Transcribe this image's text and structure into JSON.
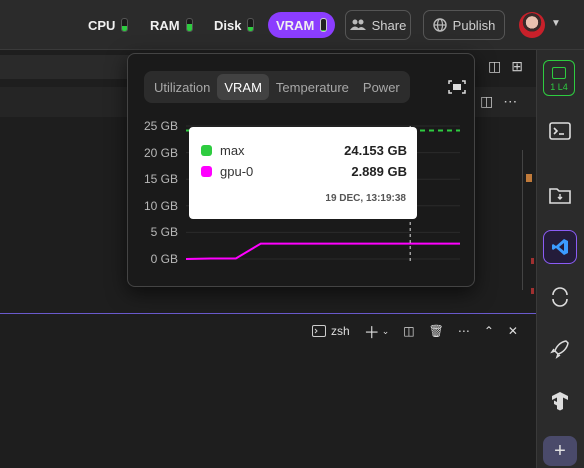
{
  "topbar": {
    "metrics": [
      {
        "label": "CPU",
        "level": 0.4
      },
      {
        "label": "RAM",
        "level": 0.55
      },
      {
        "label": "Disk",
        "level": 0.3
      },
      {
        "label": "VRAM",
        "level": 0.1
      }
    ],
    "share_label": "Share",
    "publish_label": "Publish"
  },
  "sidebar": {
    "gpu_badge": "1 L4"
  },
  "terminal": {
    "shell_label": "zsh"
  },
  "popup": {
    "tabs": [
      "Utilization",
      "VRAM",
      "Temperature",
      "Power"
    ],
    "active_tab": "VRAM",
    "tooltip": {
      "rows": [
        {
          "name": "max",
          "value": "24.153 GB",
          "color": "#2ecc40"
        },
        {
          "name": "gpu-0",
          "value": "2.889 GB",
          "color": "#ff00ff"
        }
      ],
      "time": "19 DEC, 13:19:38"
    }
  },
  "chart_data": {
    "type": "line",
    "title": "",
    "xlabel": "",
    "ylabel": "",
    "y_ticks": [
      "25 GB",
      "20 GB",
      "15 GB",
      "10 GB",
      "5 GB",
      "0 GB"
    ],
    "ylim": [
      0,
      25
    ],
    "grid": true,
    "series": [
      {
        "name": "max",
        "color": "#2ecc40",
        "style": "dashed",
        "values": [
          24.153,
          24.153,
          24.153,
          24.153,
          24.153,
          24.153,
          24.153,
          24.153,
          24.153,
          24.153,
          24.153,
          24.153
        ]
      },
      {
        "name": "gpu-0",
        "color": "#ff00ff",
        "style": "solid",
        "values": [
          0,
          0.1,
          0.1,
          2.889,
          2.889,
          2.889,
          2.889,
          2.889,
          2.889,
          2.889,
          2.889,
          2.889
        ]
      }
    ],
    "cursor_index": 9
  }
}
